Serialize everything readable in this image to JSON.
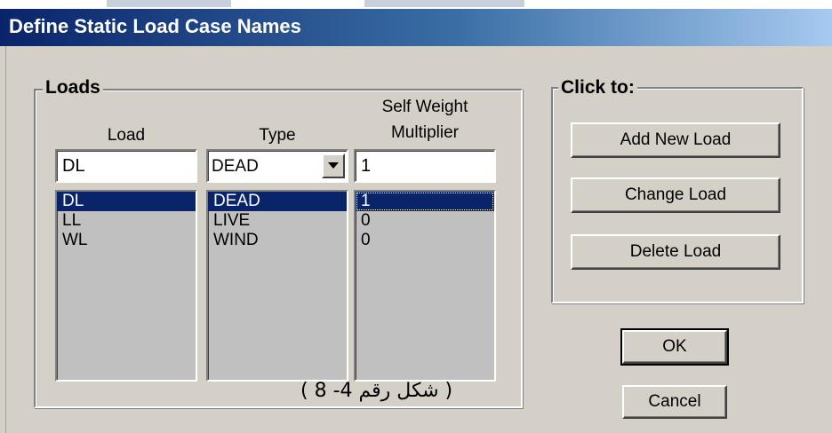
{
  "window": {
    "title": "Define Static Load Case Names"
  },
  "loads_group": {
    "label": "Loads",
    "headers": {
      "load": "Load",
      "type": "Type",
      "multiplier_line1": "Self Weight",
      "multiplier_line2": "Multiplier"
    },
    "inputs": {
      "load_name": "DL",
      "type_selected": "DEAD",
      "multiplier": "1"
    },
    "rows": [
      {
        "load": "DL",
        "type": "DEAD",
        "multiplier": "1",
        "selected": true
      },
      {
        "load": "LL",
        "type": "LIVE",
        "multiplier": "0",
        "selected": false
      },
      {
        "load": "WL",
        "type": "WIND",
        "multiplier": "0",
        "selected": false
      }
    ]
  },
  "click_group": {
    "label": "Click to:",
    "buttons": {
      "add": "Add New Load",
      "change": "Change Load",
      "delete": "Delete Load"
    }
  },
  "dialog_buttons": {
    "ok": "OK",
    "cancel": "Cancel"
  },
  "caption": "( شكل رقم 4- 8 )",
  "colors": {
    "title_gradient_start": "#0a246a",
    "title_gradient_end": "#a6caf0",
    "selection": "#0a246a",
    "dialog_face": "#d4d0c8",
    "list_background": "#c0c0c0"
  }
}
